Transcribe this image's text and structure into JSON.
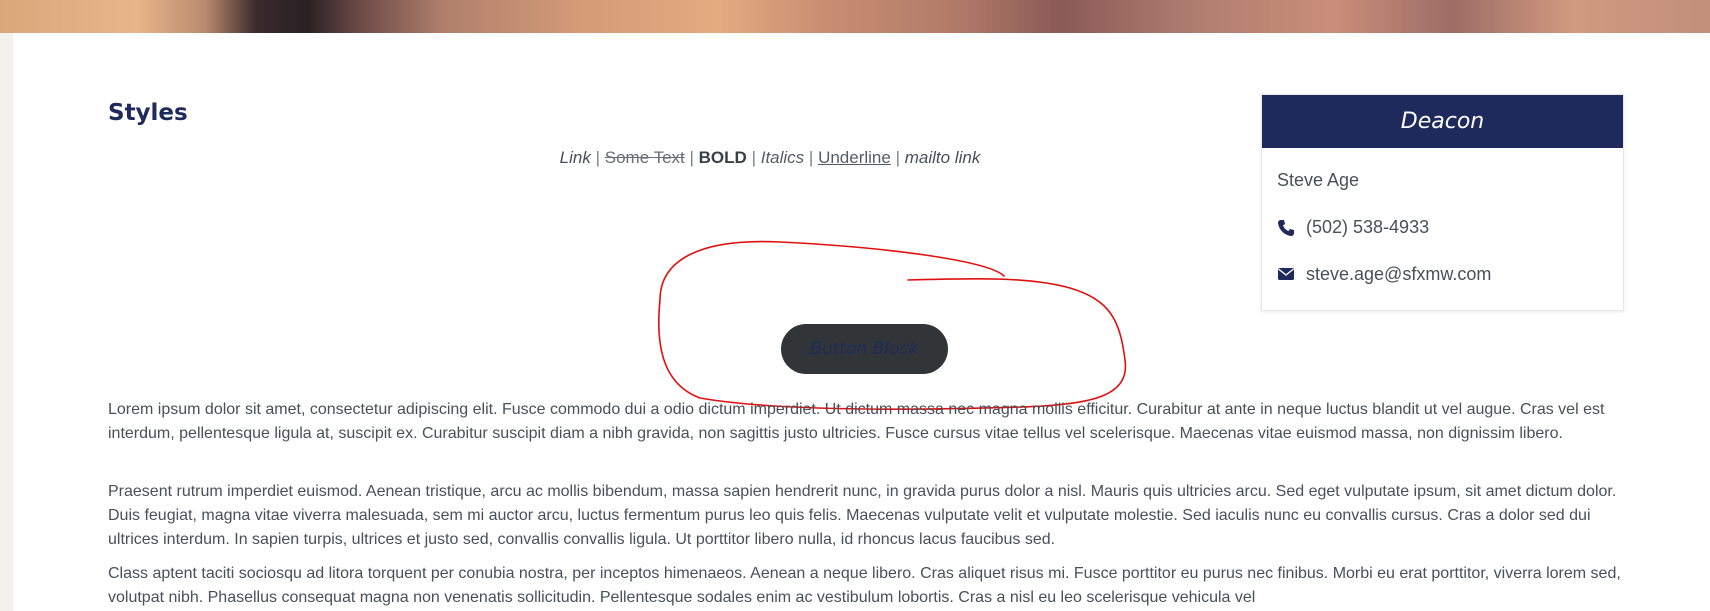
{
  "styles_section": {
    "title": "Styles",
    "link": "Link",
    "strike": "Some Text",
    "bold": "BOLD",
    "italics": "Italics",
    "underline": "Underline",
    "mailto": "mailto link",
    "separator": "|"
  },
  "button": {
    "label": "Button Block"
  },
  "paragraphs": [
    "Lorem ipsum dolor sit amet, consectetur adipiscing elit. Fusce commodo dui a odio dictum imperdiet. Ut dictum massa nec magna mollis efficitur. Curabitur at ante in neque luctus blandit ut vel augue. Cras vel est interdum, pellentesque ligula at, suscipit ex. Curabitur suscipit diam a nibh gravida, non sagittis justo ultricies. Fusce cursus vitae tellus vel scelerisque. Maecenas vitae euismod massa, non dignissim libero.",
    "Praesent rutrum imperdiet euismod. Aenean tristique, arcu ac mollis bibendum, massa sapien hendrerit nunc, in gravida purus dolor a nisl. Mauris quis ultricies arcu. Sed eget vulputate ipsum, sit amet dictum dolor. Duis feugiat, magna vitae viverra malesuada, sem mi auctor arcu, luctus fermentum purus leo quis felis. Maecenas vulputate velit et vulputate molestie. Sed iaculis nunc eu convallis cursus. Cras a dolor sed dui ultrices interdum. In sapien turpis, ultrices et justo sed, convallis convallis ligula. Ut porttitor libero nulla, id rhoncus lacus faucibus sed.",
    "Class aptent taciti sociosqu ad litora torquent per conubia nostra, per inceptos himenaeos. Aenean a neque libero. Cras aliquet risus mi. Fusce porttitor eu purus nec finibus. Morbi eu erat porttitor, viverra lorem sed, volutpat nibh. Phasellus consequat magna non venenatis sollicitudin. Pellentesque sodales enim ac vestibulum lobortis. Cras a nisl eu leo scelerisque vehicula vel"
  ],
  "contact": {
    "header": "Deacon",
    "name": "Steve Age",
    "phone": "(502) 538-4933",
    "email": "steve.age@sfxmw.com",
    "phone_icon": "phone-icon",
    "email_icon": "envelope-icon"
  },
  "colors": {
    "navy": "#1f2a5c",
    "button_bg": "#313538",
    "annotation_red": "#e01010"
  }
}
